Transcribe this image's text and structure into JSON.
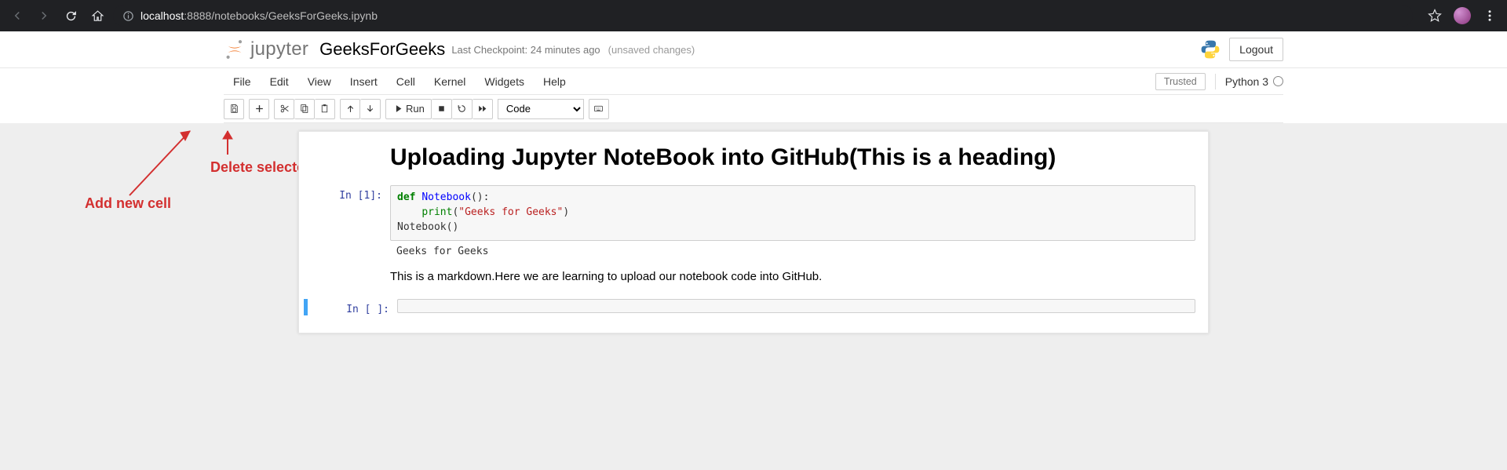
{
  "browser": {
    "url_host": "localhost",
    "url_port": ":8888",
    "url_path": "/notebooks/GeeksForGeeks.ipynb"
  },
  "header": {
    "logo_text": "jupyter",
    "notebook_title": "GeeksForGeeks",
    "checkpoint": "Last Checkpoint: 24 minutes ago",
    "unsaved": "(unsaved changes)",
    "logout": "Logout"
  },
  "menu": {
    "items": [
      "File",
      "Edit",
      "View",
      "Insert",
      "Cell",
      "Kernel",
      "Widgets",
      "Help"
    ],
    "trusted": "Trusted",
    "kernel": "Python 3"
  },
  "toolbar": {
    "run_label": "Run",
    "celltype": "Code"
  },
  "annotations": {
    "add_new_cell": "Add new cell",
    "delete_selected_cell": "Delete selected cell"
  },
  "cells": {
    "heading": "Uploading Jupyter NoteBook into GitHub(This is a heading)",
    "code_prompt": "In [1]:",
    "code_output": "Geeks for Geeks",
    "markdown_text": "This is a markdown.Here we are learning to upload our notebook code into GitHub.",
    "empty_prompt": "In [ ]:",
    "code": {
      "def": "def",
      "fn": "Notebook",
      "paren1": "():",
      "indent": "    ",
      "print": "print",
      "str": "\"Geeks for Geeks\"",
      "paren2": "(",
      "paren3": ")",
      "call": "Notebook()"
    }
  }
}
